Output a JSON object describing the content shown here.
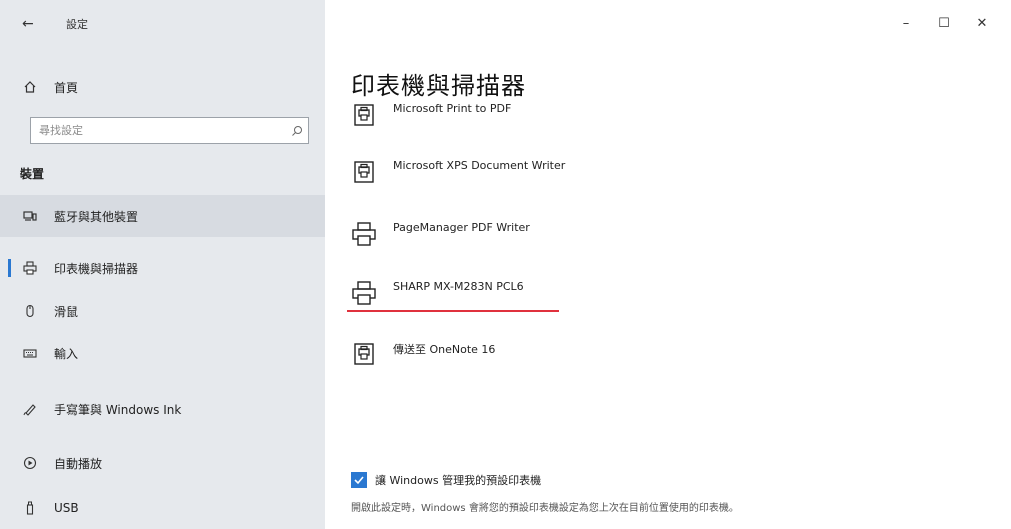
{
  "window": {
    "title": "設定",
    "controls": {
      "minimize": "–",
      "maximize": "☐",
      "close": "✕"
    }
  },
  "sidebar": {
    "home_label": "首頁",
    "search_placeholder": "尋找設定",
    "section_label": "裝置",
    "items": [
      {
        "label": "藍牙與其他裝置",
        "icon": "devices-icon"
      },
      {
        "label": "印表機與掃描器",
        "icon": "printer-icon"
      },
      {
        "label": "滑鼠",
        "icon": "mouse-icon"
      },
      {
        "label": "輸入",
        "icon": "keyboard-icon"
      },
      {
        "label": "手寫筆與 Windows Ink",
        "icon": "pen-icon"
      },
      {
        "label": "自動播放",
        "icon": "autoplay-icon"
      },
      {
        "label": "USB",
        "icon": "usb-icon"
      }
    ]
  },
  "main": {
    "title": "印表機與掃描器",
    "printers": [
      {
        "name": "Microsoft Print to PDF",
        "icon": "virtual-printer-icon"
      },
      {
        "name": "Microsoft XPS Document Writer",
        "icon": "virtual-printer-icon"
      },
      {
        "name": "PageManager PDF Writer",
        "icon": "printer-icon"
      },
      {
        "name": "SHARP MX-M283N PCL6",
        "icon": "printer-icon"
      },
      {
        "name": "傳送至 OneNote 16",
        "icon": "virtual-printer-icon"
      }
    ],
    "default_checkbox": {
      "label": "讓 Windows 管理我的預設印表機",
      "checked": true
    },
    "description": "開啟此設定時，Windows 會將您的預設印表機設定為您上次在目前位置使用的印表機。"
  },
  "colors": {
    "accent": "#2a78d1",
    "highlight_underline": "#e0313d",
    "sidebar_bg": "#e6e9ed"
  }
}
